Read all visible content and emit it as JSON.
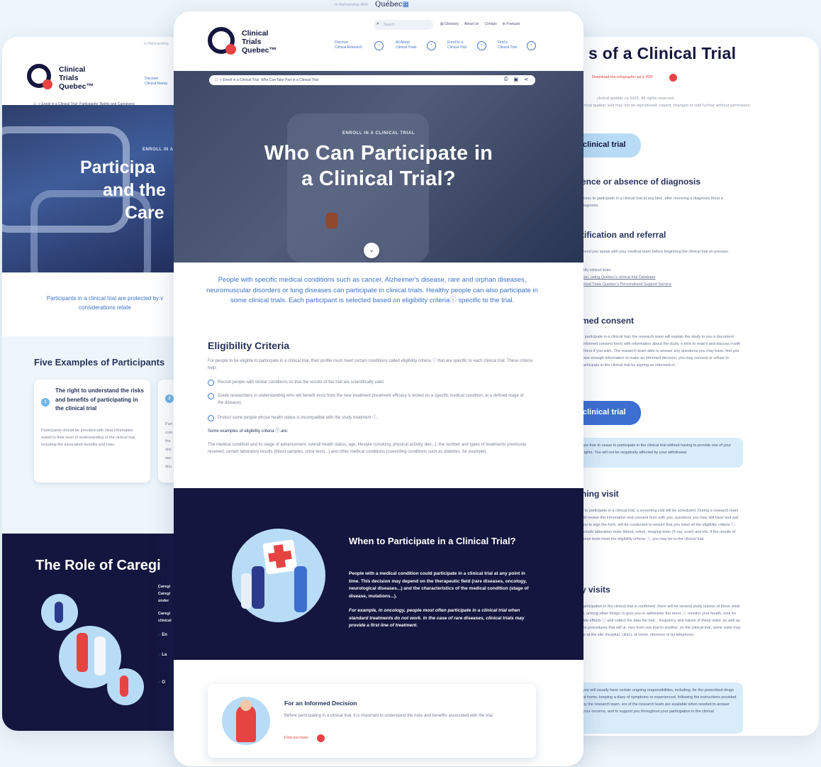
{
  "left": {
    "partner": "In Partnership",
    "logo": {
      "line1": "Clinical",
      "line2": "Trials",
      "line3": "Quebec™"
    },
    "nav": {
      "line1": "Discover",
      "line2": "Clinical Resea"
    },
    "breadcrumb": {
      "crumb1": "« Enroll in a Clinical Trial",
      "crumb2": "Participants' Rights and Caregivers"
    },
    "hero": {
      "eyebrow": "ENROLL IN A",
      "line1": "Participa",
      "line2": "and the",
      "line3": "Care"
    },
    "intro": "Participants in a clinical trial are protected by v considerations relate",
    "examples_title": "Five Examples of Participants",
    "example1": {
      "num": "1",
      "title": "The right to understand the risks and benefits of participating in the clinical trial",
      "body": "Participants should be provided with clear information suited to their level of understanding of the clinical trial, including the associated benefits and risks."
    },
    "example2": {
      "num": "2",
      "body": "Part com the sho nec dou"
    },
    "role_title": "The Role of Caregi",
    "role_text": [
      "Caregi",
      "Caregi",
      "under",
      "Caregi",
      "clinical"
    ],
    "role_items": [
      "En",
      "La",
      "O"
    ]
  },
  "center": {
    "partner_text": "In Partnership With",
    "quebec_logo": "Québec",
    "search_placeholder": "Search",
    "utility": {
      "glossary": "Glossary",
      "about": "About Us",
      "contact": "Contact",
      "lang": "Français"
    },
    "logo": {
      "line1": "Clinical",
      "line2": "Trials",
      "line3": "Quebec™"
    },
    "nav": [
      {
        "line1": "Discover",
        "line2": "Clinical Research"
      },
      {
        "line1": "All About",
        "line2": "Clinical Trials"
      },
      {
        "line1": "Enroll in a",
        "line2": "Clinical Trial"
      },
      {
        "line1": "Find a",
        "line2": "Clinical Trial"
      }
    ],
    "breadcrumb": {
      "crumb1": "« Enroll in a Clinical Trial",
      "crumb2": "Who Can Take Part in a Clinical Trial"
    },
    "hero": {
      "eyebrow": "ENROLL IN A CLINICAL TRIAL",
      "line1": "Who Can Participate in",
      "line2": "a Clinical Trial?"
    },
    "intro": "People with specific medical conditions such as cancer, Alzheimer's disease, rare and orphan diseases, neuromuscular disorders or lung diseases can participate in clinical trials. Healthy people can also participate in some clinical trials. Each participant is selected based on eligibility criteriaⓘ specific to the trial.",
    "eligibility": {
      "title": "Eligibility Criteria",
      "intro": "For people to be eligible to participate in a clinical trial, their profile must meet certain conditions called eligibility criteria ⓘ that are specific to each clinical trial. These criteria help:",
      "items": [
        "Recruit people with similar conditions so that the results of the trial are scientifically valid.",
        "Guide researchers in understanding who will benefit most from the new treatment (treatment efficacy is tested on a specific medical condition, at a defined stage of the disease).",
        "Protect some people whose health status is incompatible with the study treatment ⓘ."
      ],
      "examples_label": "Some examples of eligibility criteria ⓘ are:",
      "examples_text": "The medical condition and its stage of advancement, overall health status, age, lifestyle (smoking, physical activity, diet...), the number and types of treatments previously received, certain laboratory results (blood samples, urine tests...) and other medical conditions (coexisting conditions such as diabetes, for example)."
    },
    "when": {
      "title": "When to Participate in a Clinical Trial?",
      "p1": "People with a medical condition could participate in a clinical trial at any point in time. This decision may depend on the therapeutic field (rare diseases, oncology, neurological diseases...) and the characteristics of the medical condition (stage of disease, mutations...).",
      "p2": "For example, in oncology, people most often participate in a clinical trial when standard treatments do not work. In the case of rare diseases, clinical trials may provide a first line of treatment."
    },
    "informed": {
      "title": "For an Informed Decision",
      "text": "Before participating in a clinical trial, it is important to understand the risks and benefits associated with the trial.",
      "link": "Find out more"
    }
  },
  "right": {
    "title": "s of a Clinical Trial",
    "download": "Download the infographic as a PDF",
    "copyright1": "clinical quebec.ca 2025. All rights reserved.",
    "copyright2": "inical quebec and may not be reproduced, copied, changed or sold further without permission.",
    "pill1": "clinical trial",
    "h_diag": "ence or absence of diagnosis",
    "t_diag": "ccess to participate in a clinical trial at any time, after receiving a diagnosis thout a diagnosis.",
    "h_ident": "tification and referral",
    "t_ident": "mend you speak with your medical team before beginning the clinical trial on process.",
    "ident_links": [
      "ntify clinical trials:",
      "own, using Québec's clinical trial Database",
      "linical Trials Quebec's Personalized Support Service"
    ],
    "h_consent": "med consent",
    "t_consent": "o participate in a clinical trial, the research team will explain the study to you a document (informed consent form) with information about the study. e time to read it and discuss it with others if you wish. The research team able to answer any questions you may have. feel you have enough information to make an informed decision, you may consent or refuse to participate in the clinical trial by signing an informed m.",
    "pill2": "clinical trial",
    "box1": "are free to cease to participate in the clinical trial without having to provide one of your rights. You will not be negatively affected by your withdrawal.",
    "h_screen": "ning visit",
    "t_screen": "e to participate in a clinical trial, a screening visit will be scheduled. During e research team will review the information and consent form with you, questions you may still have and ask you to sign the form. will be conducted to ensure that you meet all the eligibility criteria ⓘ. include laboratory tests (blood, urine), imaging tests (X-ray, scan) and ets. If the results of these tests meet the eligibility criteria ⓘ, you may be to the clinical trial.",
    "h_visits": "y visits",
    "t_visits": "participation in the clinical trial is confirmed, there will be several study urpose of these visits is, among other things, to give you or administer the ment ⓘ, monitor your health, look for side effects ⓘ and collect the data the trial. , frequency and nature of these visits, as well as the procedures that will ut, vary from one trial to another. on the clinical trial, some visits may be at the site (hospital, clinic), at home, nference or by telephone.",
    "box2": "you will usually have certain ongoing responsibilities, including, for the prescribed drugs at home, keeping a diary of symptoms or experienced, following the instructions provided by the research team. ers of the research team are available when needed to answer your oncerns, and to support you throughout your participation in the clinical"
  },
  "colors": {
    "navy": "#14163f",
    "blue": "#3d73c9",
    "red": "#e64343",
    "lightblue": "#b8dcf5"
  }
}
